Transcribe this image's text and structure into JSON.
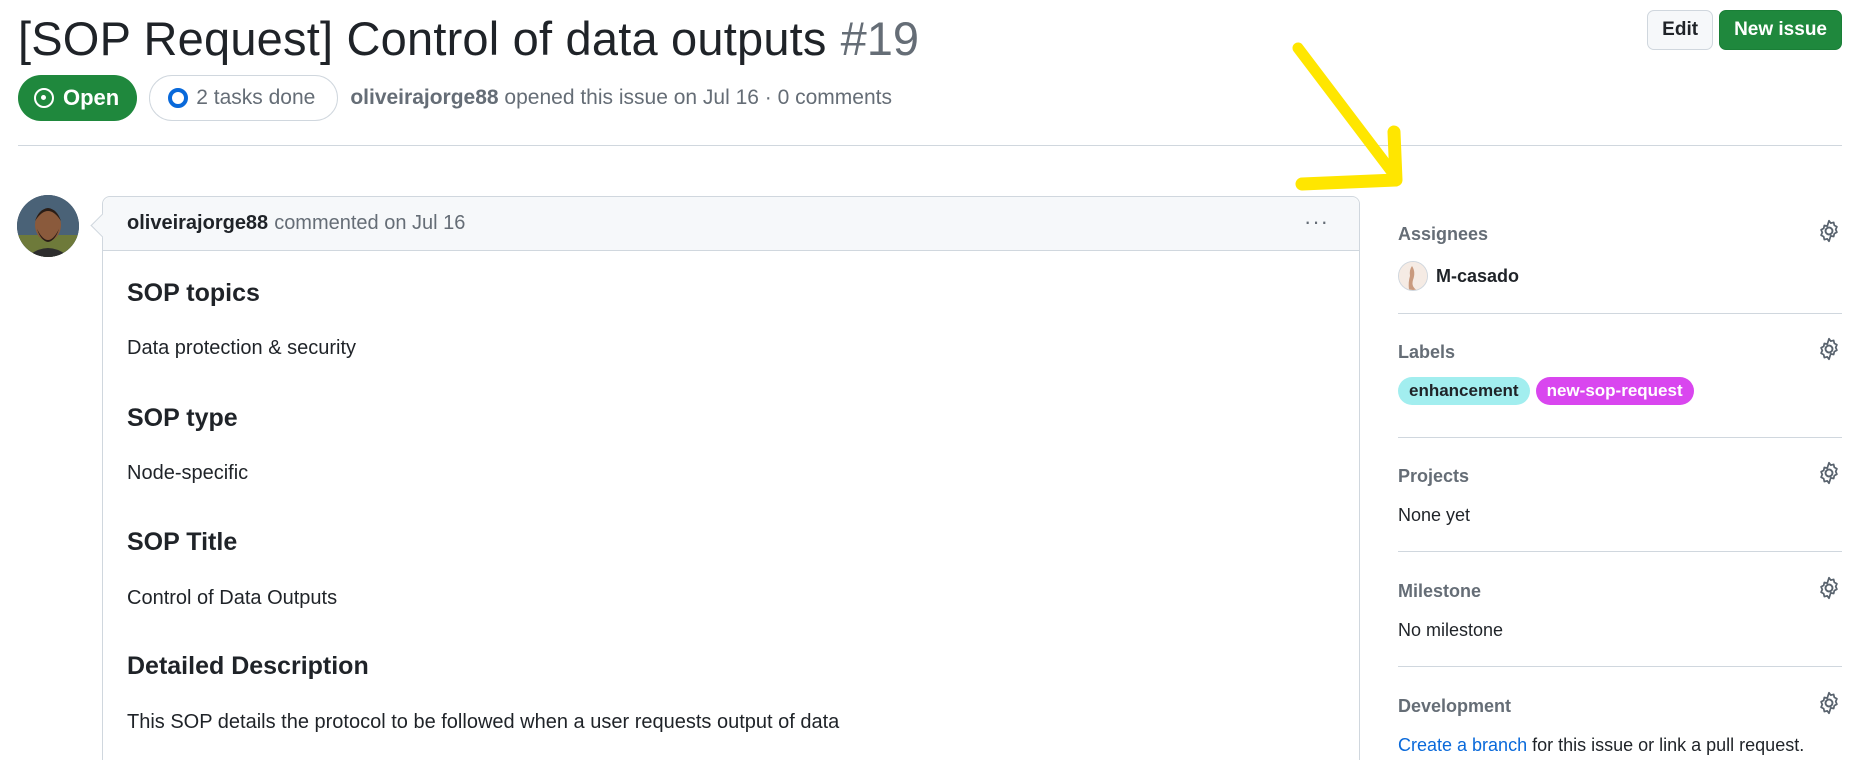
{
  "issue": {
    "title": "[SOP Request] Control of data outputs",
    "number": "#19",
    "state": "Open",
    "tasks": "2 tasks done",
    "author": "oliveirajorge88",
    "opened_text": "opened this issue on Jul 16 · 0 comments"
  },
  "header": {
    "edit_label": "Edit",
    "new_issue_label": "New issue"
  },
  "comment": {
    "author": "oliveirajorge88",
    "action": "commented on Jul 16",
    "menu_label": "···",
    "sections": [
      {
        "heading": "SOP topics",
        "text": "Data protection & security"
      },
      {
        "heading": "SOP type",
        "text": "Node-specific"
      },
      {
        "heading": "SOP Title",
        "text": "Control of Data Outputs"
      },
      {
        "heading": "Detailed Description",
        "text": "This SOP details the protocol to be followed when a user requests output of data"
      }
    ]
  },
  "sidebar": {
    "assignees": {
      "heading": "Assignees",
      "user": "M-casado"
    },
    "labels": {
      "heading": "Labels",
      "items": [
        "enhancement",
        "new-sop-request"
      ]
    },
    "projects": {
      "heading": "Projects",
      "value": "None yet"
    },
    "milestone": {
      "heading": "Milestone",
      "value": "No milestone"
    },
    "development": {
      "heading": "Development",
      "link_text": "Create a branch",
      "rest_text": " for this issue or link a pull request."
    }
  },
  "colors": {
    "open_green": "#1f883d",
    "label_enhancement": "#a2eeef",
    "label_sop": "#d946ef",
    "annotation_arrow": "#ffe600",
    "link_blue": "#0969da"
  },
  "icons": [
    "issue-opened-icon",
    "task-progress-icon",
    "kebab-menu-icon",
    "gear-icon",
    "annotation-arrow"
  ]
}
